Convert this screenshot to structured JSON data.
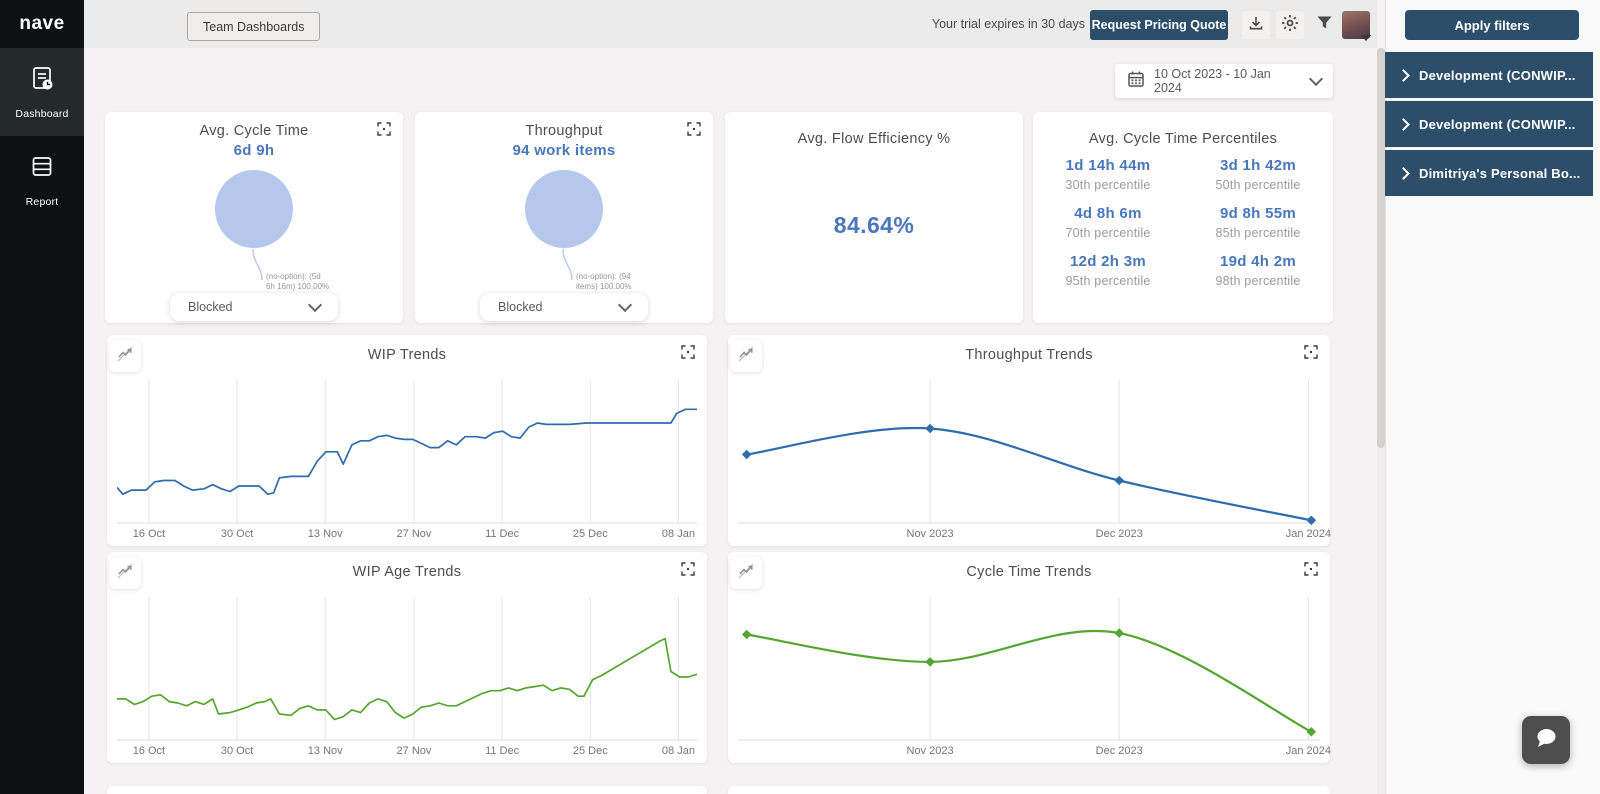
{
  "app": {
    "logo": "nave"
  },
  "sidebar": {
    "items": [
      {
        "label": "Dashboard",
        "icon": "dashboard-clock-icon",
        "active": true
      },
      {
        "label": "Report",
        "icon": "report-icon",
        "active": false
      }
    ]
  },
  "header": {
    "team_dashboards_label": "Team Dashboards",
    "trial_text": "Your trial expires in 30 days",
    "request_quote_label": "Request Pricing Quote",
    "icons": [
      "download-icon",
      "settings-gear-icon",
      "filter-icon",
      "user-avatar"
    ]
  },
  "filters_panel": {
    "apply_button_label": "Apply filters",
    "boards": [
      "Development (CONWIP...",
      "Development (CONWIP...",
      "Dimitriya's Personal Bo..."
    ]
  },
  "date_range": {
    "label": "10 Oct 2023 - 10 Jan 2024",
    "icon": "calendar-icon"
  },
  "cards": {
    "cycle_time": {
      "title": "Avg. Cycle Time",
      "value": "6d 9h",
      "pie_label_line1": "(no-option): (5d",
      "pie_label_line2": "6h 16m) 100.00%",
      "pie_color": "#b5c8ec",
      "dropdown_value": "Blocked"
    },
    "throughput": {
      "title": "Throughput",
      "value": "94 work items",
      "pie_label_line1": "(no-option): (94",
      "pie_label_line2": "items) 100.00%",
      "pie_color": "#b5c8ec",
      "dropdown_value": "Blocked"
    },
    "flow_efficiency": {
      "title": "Avg. Flow Efficiency %",
      "value": "84.64%"
    },
    "percentiles": {
      "title": "Avg. Cycle Time Percentiles",
      "items": [
        {
          "value": "1d 14h 44m",
          "label": "30th percentile"
        },
        {
          "value": "3d 1h 42m",
          "label": "50th percentile"
        },
        {
          "value": "4d 8h 6m",
          "label": "70th percentile"
        },
        {
          "value": "9d 8h 55m",
          "label": "85th percentile"
        },
        {
          "value": "12d 2h 3m",
          "label": "95th percentile"
        },
        {
          "value": "19d 4h 2m",
          "label": "98th percentile"
        }
      ]
    }
  },
  "chart_data": [
    {
      "id": "wip_trends",
      "type": "line",
      "title": "WIP Trends",
      "color": "#2e6cad",
      "smooth": false,
      "markers": false,
      "grid": "vertical",
      "legend": "none",
      "ylabel": "",
      "xlabel": "",
      "ylim_relative_pct": [
        0,
        100
      ],
      "x_ticks": [
        "16 Oct",
        "30 Oct",
        "13 Nov",
        "27 Nov",
        "11 Dec",
        "25 Dec",
        "08 Jan"
      ],
      "tick_pos_pct": [
        5.5,
        20.7,
        35.9,
        51.2,
        66.4,
        81.6,
        96.8
      ],
      "points": [
        [
          0,
          26
        ],
        [
          1,
          21
        ],
        [
          2.5,
          24
        ],
        [
          5,
          24
        ],
        [
          6.5,
          30
        ],
        [
          8,
          31
        ],
        [
          10,
          31
        ],
        [
          11.5,
          27
        ],
        [
          13,
          24
        ],
        [
          15,
          25
        ],
        [
          16.5,
          28
        ],
        [
          18,
          25
        ],
        [
          19.5,
          23
        ],
        [
          21,
          27
        ],
        [
          22.5,
          27
        ],
        [
          24.5,
          27
        ],
        [
          26,
          21
        ],
        [
          27,
          22
        ],
        [
          28,
          33
        ],
        [
          30,
          34
        ],
        [
          33,
          34
        ],
        [
          34.5,
          45
        ],
        [
          36,
          52
        ],
        [
          38,
          52
        ],
        [
          39,
          43
        ],
        [
          40.5,
          57
        ],
        [
          42,
          60
        ],
        [
          43.5,
          60
        ],
        [
          45,
          63
        ],
        [
          46.5,
          64
        ],
        [
          48,
          62
        ],
        [
          49.5,
          61
        ],
        [
          51,
          61
        ],
        [
          52.5,
          58
        ],
        [
          54,
          55
        ],
        [
          55.5,
          55
        ],
        [
          57,
          60
        ],
        [
          58.5,
          57
        ],
        [
          60,
          63
        ],
        [
          62,
          63
        ],
        [
          63.5,
          62
        ],
        [
          65,
          66
        ],
        [
          66.5,
          67
        ],
        [
          68,
          63
        ],
        [
          69.5,
          62
        ],
        [
          71,
          70
        ],
        [
          72.5,
          73
        ],
        [
          74,
          72
        ],
        [
          75.5,
          72
        ],
        [
          78,
          72
        ],
        [
          81,
          73
        ],
        [
          95.5,
          73
        ],
        [
          96.5,
          80
        ],
        [
          98,
          83
        ],
        [
          100,
          83
        ]
      ]
    },
    {
      "id": "throughput_trends",
      "type": "line",
      "title": "Throughput Trends",
      "color": "#2e6cad",
      "smooth": true,
      "markers": true,
      "grid": "vertical",
      "legend": "none",
      "ylabel": "",
      "xlabel": "",
      "ylim_relative_pct": [
        0,
        100
      ],
      "x_ticks": [
        "Nov 2023",
        "Dec 2023",
        "Jan 2024"
      ],
      "tick_pos_pct": [
        33,
        65.5,
        98
      ],
      "points": [
        [
          1.5,
          50
        ],
        [
          33,
          69
        ],
        [
          65.5,
          31
        ],
        [
          98.5,
          2
        ]
      ]
    },
    {
      "id": "wip_age_trends",
      "type": "line",
      "title": "WIP Age Trends",
      "color": "#55a630",
      "smooth": false,
      "markers": false,
      "grid": "vertical",
      "legend": "none",
      "ylabel": "",
      "xlabel": "",
      "ylim_relative_pct": [
        0,
        100
      ],
      "x_ticks": [
        "16 Oct",
        "30 Oct",
        "13 Nov",
        "27 Nov",
        "11 Dec",
        "25 Dec",
        "08 Jan"
      ],
      "tick_pos_pct": [
        5.5,
        20.7,
        35.9,
        51.2,
        66.4,
        81.6,
        96.8
      ],
      "points": [
        [
          0,
          30
        ],
        [
          1.5,
          30
        ],
        [
          3,
          26
        ],
        [
          4.5,
          28
        ],
        [
          6,
          32
        ],
        [
          7.5,
          33
        ],
        [
          9,
          28
        ],
        [
          10.5,
          27
        ],
        [
          12,
          25
        ],
        [
          13.5,
          28
        ],
        [
          15,
          26
        ],
        [
          16.5,
          30
        ],
        [
          17.5,
          19
        ],
        [
          19.5,
          20
        ],
        [
          21,
          22
        ],
        [
          22.5,
          24
        ],
        [
          24,
          27
        ],
        [
          25.5,
          28
        ],
        [
          26.5,
          30
        ],
        [
          28,
          19
        ],
        [
          30,
          18
        ],
        [
          31.5,
          23
        ],
        [
          33,
          25
        ],
        [
          34.5,
          22
        ],
        [
          36,
          22
        ],
        [
          37.5,
          15
        ],
        [
          39,
          17
        ],
        [
          40.5,
          22
        ],
        [
          42,
          20
        ],
        [
          43.5,
          27
        ],
        [
          45,
          30
        ],
        [
          46.5,
          28
        ],
        [
          48,
          20
        ],
        [
          49.5,
          16
        ],
        [
          51,
          19
        ],
        [
          52.5,
          24
        ],
        [
          54,
          25
        ],
        [
          55.5,
          27
        ],
        [
          57,
          25
        ],
        [
          58.5,
          25
        ],
        [
          60,
          28
        ],
        [
          61.5,
          31
        ],
        [
          63,
          34
        ],
        [
          64.5,
          36
        ],
        [
          66,
          36
        ],
        [
          67.5,
          38
        ],
        [
          69,
          36
        ],
        [
          70.5,
          38
        ],
        [
          72,
          39
        ],
        [
          73.5,
          40
        ],
        [
          75,
          36
        ],
        [
          76.5,
          38
        ],
        [
          78,
          37
        ],
        [
          79.5,
          32
        ],
        [
          80.5,
          32
        ],
        [
          82,
          44
        ],
        [
          83.5,
          47
        ],
        [
          93.5,
          72
        ],
        [
          94.5,
          74
        ],
        [
          95.5,
          50
        ],
        [
          97,
          46
        ],
        [
          98.5,
          46
        ],
        [
          100,
          48
        ]
      ]
    },
    {
      "id": "cycle_time_trends",
      "type": "line",
      "title": "Cycle Time Trends",
      "color": "#55a630",
      "smooth": true,
      "markers": true,
      "grid": "vertical",
      "legend": "none",
      "ylabel": "",
      "xlabel": "",
      "ylim_relative_pct": [
        0,
        100
      ],
      "x_ticks": [
        "Nov 2023",
        "Dec 2023",
        "Jan 2024"
      ],
      "tick_pos_pct": [
        33,
        65.5,
        98
      ],
      "points": [
        [
          1.5,
          77
        ],
        [
          33,
          57
        ],
        [
          65.5,
          78
        ],
        [
          98.5,
          6
        ]
      ]
    }
  ]
}
